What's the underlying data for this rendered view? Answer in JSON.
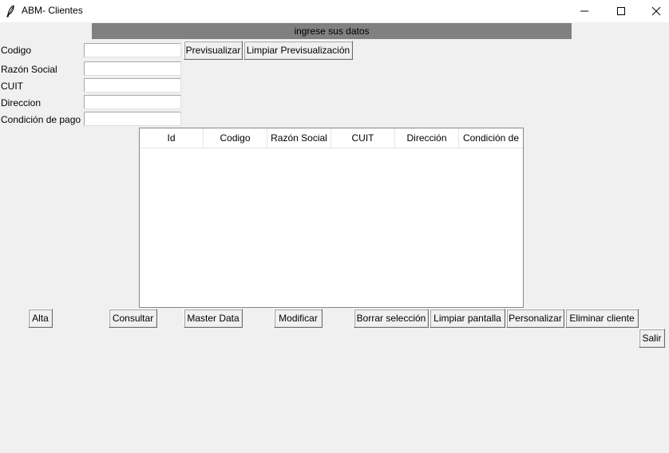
{
  "window": {
    "title": "ABM- Clientes",
    "minimize_glyph": "—",
    "maximize_glyph": "☐",
    "close_glyph": "✕"
  },
  "banner": "ingrese sus datos",
  "form": {
    "fields": [
      {
        "label": "Codigo",
        "value": ""
      },
      {
        "label": "Razón Social",
        "value": ""
      },
      {
        "label": "CUIT",
        "value": ""
      },
      {
        "label": "Direccion",
        "value": ""
      },
      {
        "label": "Condición de pago",
        "value": ""
      }
    ],
    "preview_button": "Previsualizar",
    "clear_preview_button": "Limpiar Previsualización"
  },
  "table": {
    "columns": [
      "Id",
      "Codigo",
      "Razón Social",
      "CUIT",
      "Dirección",
      "Condición de"
    ],
    "rows": []
  },
  "actions": {
    "alta": "Alta",
    "consultar": "Consultar",
    "master_data": "Master Data",
    "modificar": "Modificar",
    "borrar_seleccion": "Borrar selección",
    "limpiar_pantalla": "Limpiar pantalla",
    "personalizar": "Personalizar",
    "eliminar_cliente": "Eliminar cliente",
    "salir": "Salir"
  },
  "colors": {
    "background": "#f0f0f0",
    "banner": "#808080",
    "titlebar": "#ffffff"
  },
  "icons": {
    "app": "feather-icon",
    "minimize": "minimize-icon",
    "maximize": "maximize-icon",
    "close": "close-icon"
  }
}
